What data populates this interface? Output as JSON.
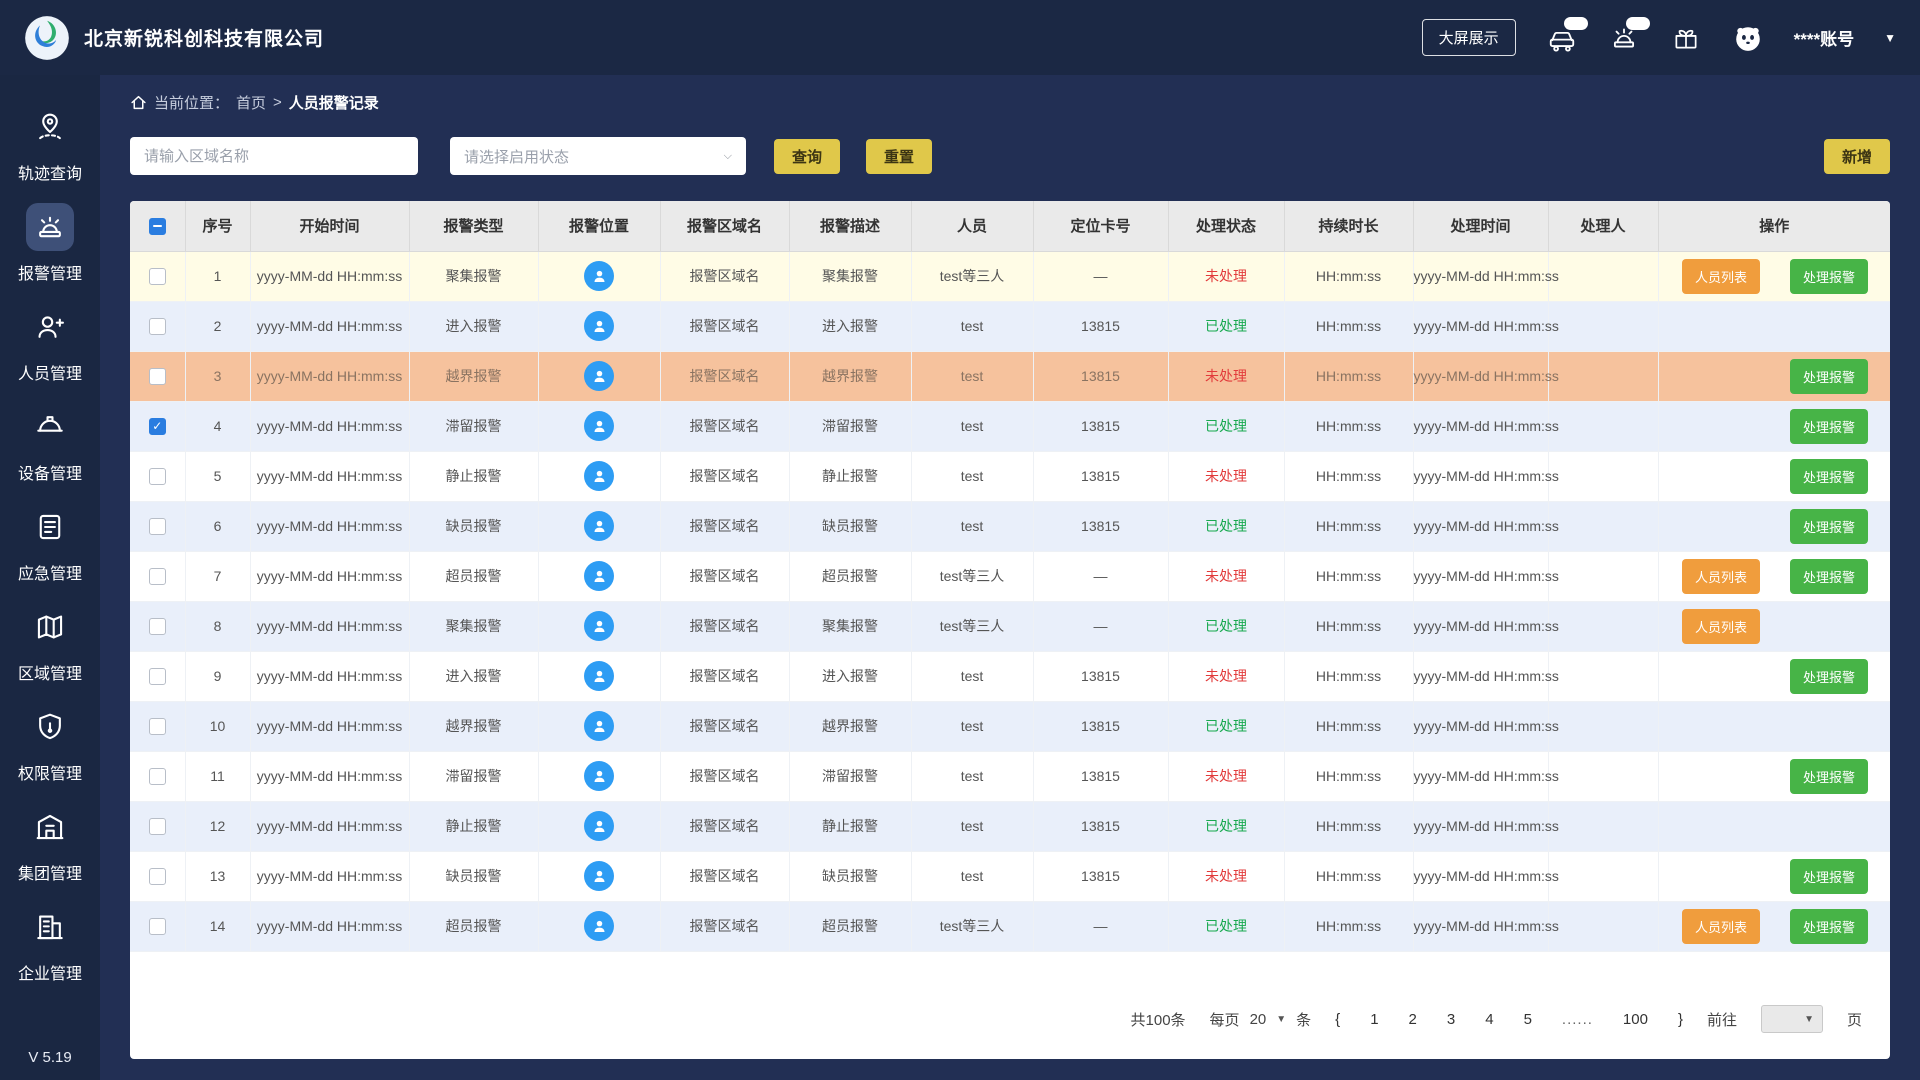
{
  "header": {
    "company": "北京新锐科创科技有限公司",
    "big_screen": "大屏展示",
    "account": "****账号"
  },
  "sidebar": {
    "version": "V 5.19",
    "items": [
      {
        "id": "track-query",
        "label": "轨迹查询",
        "active": false
      },
      {
        "id": "alarm-management",
        "label": "报警管理",
        "active": true
      },
      {
        "id": "personnel-management",
        "label": "人员管理",
        "active": false
      },
      {
        "id": "device-management",
        "label": "设备管理",
        "active": false
      },
      {
        "id": "emergency-management",
        "label": "应急管理",
        "active": false
      },
      {
        "id": "region-management",
        "label": "区域管理",
        "active": false
      },
      {
        "id": "permission-management",
        "label": "权限管理",
        "active": false
      },
      {
        "id": "group-management",
        "label": "集团管理",
        "active": false
      },
      {
        "id": "enterprise-management",
        "label": "企业管理",
        "active": false
      }
    ]
  },
  "breadcrumb": {
    "label": "当前位置：",
    "home": "首页",
    "sep": ">",
    "current": "人员报警记录"
  },
  "toolbar": {
    "search_placeholder": "请输入区域名称",
    "select_placeholder": "请选择启用状态",
    "query": "查询",
    "reset": "重置",
    "add": "新增"
  },
  "table": {
    "columns": [
      "序号",
      "开始时间",
      "报警类型",
      "报警位置",
      "报警区域名",
      "报警描述",
      "人员",
      "定位卡号",
      "处理状态",
      "持续时长",
      "处理时间",
      "处理人",
      "操作"
    ],
    "status_labels": {
      "pending": "未处理",
      "done": "已处理"
    },
    "action_labels": {
      "list": "人员列表",
      "handle": "处理报警"
    },
    "rows": [
      {
        "no": "1",
        "start": "yyyy-MM-dd HH:mm:ss",
        "type": "聚集报警",
        "area": "报警区域名",
        "desc": "聚集报警",
        "person": "test等三人",
        "card": "—",
        "status": "pending",
        "duration": "HH:mm:ss",
        "time": "yyyy-MM-dd HH:mm:ss",
        "handler": "",
        "bg": "yellow",
        "checked": false,
        "actions": [
          "list",
          "handle"
        ]
      },
      {
        "no": "2",
        "start": "yyyy-MM-dd HH:mm:ss",
        "type": "进入报警",
        "area": "报警区域名",
        "desc": "进入报警",
        "person": "test",
        "card": "13815",
        "status": "done",
        "duration": "HH:mm:ss",
        "time": "yyyy-MM-dd HH:mm:ss",
        "handler": "",
        "bg": "blue",
        "checked": false,
        "actions": []
      },
      {
        "no": "3",
        "start": "yyyy-MM-dd HH:mm:ss",
        "type": "越界报警",
        "area": "报警区域名",
        "desc": "越界报警",
        "person": "test",
        "card": "13815",
        "status": "pending",
        "duration": "HH:mm:ss",
        "time": "yyyy-MM-dd HH:mm:ss",
        "handler": "",
        "bg": "orange",
        "checked": false,
        "actions": [
          "handle"
        ]
      },
      {
        "no": "4",
        "start": "yyyy-MM-dd HH:mm:ss",
        "type": "滞留报警",
        "area": "报警区域名",
        "desc": "滞留报警",
        "person": "test",
        "card": "13815",
        "status": "done",
        "duration": "HH:mm:ss",
        "time": "yyyy-MM-dd HH:mm:ss",
        "handler": "",
        "bg": "blue",
        "checked": true,
        "actions": [
          "handle"
        ]
      },
      {
        "no": "5",
        "start": "yyyy-MM-dd HH:mm:ss",
        "type": "静止报警",
        "area": "报警区域名",
        "desc": "静止报警",
        "person": "test",
        "card": "13815",
        "status": "pending",
        "duration": "HH:mm:ss",
        "time": "yyyy-MM-dd HH:mm:ss",
        "handler": "",
        "bg": "white",
        "checked": false,
        "actions": [
          "handle"
        ]
      },
      {
        "no": "6",
        "start": "yyyy-MM-dd HH:mm:ss",
        "type": "缺员报警",
        "area": "报警区域名",
        "desc": "缺员报警",
        "person": "test",
        "card": "13815",
        "status": "done",
        "duration": "HH:mm:ss",
        "time": "yyyy-MM-dd HH:mm:ss",
        "handler": "",
        "bg": "blue",
        "checked": false,
        "actions": [
          "handle"
        ]
      },
      {
        "no": "7",
        "start": "yyyy-MM-dd HH:mm:ss",
        "type": "超员报警",
        "area": "报警区域名",
        "desc": "超员报警",
        "person": "test等三人",
        "card": "—",
        "status": "pending",
        "duration": "HH:mm:ss",
        "time": "yyyy-MM-dd HH:mm:ss",
        "handler": "",
        "bg": "white",
        "checked": false,
        "actions": [
          "list",
          "handle"
        ]
      },
      {
        "no": "8",
        "start": "yyyy-MM-dd HH:mm:ss",
        "type": "聚集报警",
        "area": "报警区域名",
        "desc": "聚集报警",
        "person": "test等三人",
        "card": "—",
        "status": "done",
        "duration": "HH:mm:ss",
        "time": "yyyy-MM-dd HH:mm:ss",
        "handler": "",
        "bg": "blue",
        "checked": false,
        "actions": [
          "list"
        ]
      },
      {
        "no": "9",
        "start": "yyyy-MM-dd HH:mm:ss",
        "type": "进入报警",
        "area": "报警区域名",
        "desc": "进入报警",
        "person": "test",
        "card": "13815",
        "status": "pending",
        "duration": "HH:mm:ss",
        "time": "yyyy-MM-dd HH:mm:ss",
        "handler": "",
        "bg": "white",
        "checked": false,
        "actions": [
          "handle"
        ]
      },
      {
        "no": "10",
        "start": "yyyy-MM-dd HH:mm:ss",
        "type": "越界报警",
        "area": "报警区域名",
        "desc": "越界报警",
        "person": "test",
        "card": "13815",
        "status": "done",
        "duration": "HH:mm:ss",
        "time": "yyyy-MM-dd HH:mm:ss",
        "handler": "",
        "bg": "blue",
        "checked": false,
        "actions": []
      },
      {
        "no": "11",
        "start": "yyyy-MM-dd HH:mm:ss",
        "type": "滞留报警",
        "area": "报警区域名",
        "desc": "滞留报警",
        "person": "test",
        "card": "13815",
        "status": "pending",
        "duration": "HH:mm:ss",
        "time": "yyyy-MM-dd HH:mm:ss",
        "handler": "",
        "bg": "white",
        "checked": false,
        "actions": [
          "handle"
        ]
      },
      {
        "no": "12",
        "start": "yyyy-MM-dd HH:mm:ss",
        "type": "静止报警",
        "area": "报警区域名",
        "desc": "静止报警",
        "person": "test",
        "card": "13815",
        "status": "done",
        "duration": "HH:mm:ss",
        "time": "yyyy-MM-dd HH:mm:ss",
        "handler": "",
        "bg": "blue",
        "checked": false,
        "actions": []
      },
      {
        "no": "13",
        "start": "yyyy-MM-dd HH:mm:ss",
        "type": "缺员报警",
        "area": "报警区域名",
        "desc": "缺员报警",
        "person": "test",
        "card": "13815",
        "status": "pending",
        "duration": "HH:mm:ss",
        "time": "yyyy-MM-dd HH:mm:ss",
        "handler": "",
        "bg": "white",
        "checked": false,
        "actions": [
          "handle"
        ]
      },
      {
        "no": "14",
        "start": "yyyy-MM-dd HH:mm:ss",
        "type": "超员报警",
        "area": "报警区域名",
        "desc": "超员报警",
        "person": "test等三人",
        "card": "—",
        "status": "done",
        "duration": "HH:mm:ss",
        "time": "yyyy-MM-dd HH:mm:ss",
        "handler": "",
        "bg": "blue",
        "checked": false,
        "actions": [
          "list",
          "handle"
        ]
      }
    ]
  },
  "pagination": {
    "total": "共100条",
    "per_page_label": "每页",
    "per_page_value": "20",
    "unit": "条",
    "prev": "{",
    "pages": [
      "1",
      "2",
      "3",
      "4",
      "5"
    ],
    "ellipsis": "......",
    "last_page": "100",
    "next": "}",
    "goto_label": "前往",
    "page_unit": "页"
  }
}
